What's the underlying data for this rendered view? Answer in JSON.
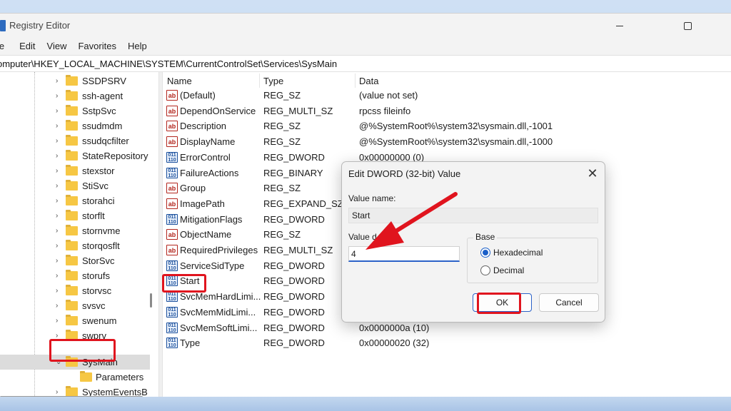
{
  "window": {
    "title": "Registry Editor",
    "menu": [
      "le",
      "Edit",
      "View",
      "Favorites",
      "Help"
    ],
    "address": "omputer\\HKEY_LOCAL_MACHINE\\SYSTEM\\CurrentControlSet\\Services\\SysMain"
  },
  "tree": {
    "items": [
      {
        "label": "SSDPSRV"
      },
      {
        "label": "ssh-agent"
      },
      {
        "label": "SstpSvc"
      },
      {
        "label": "ssudmdm"
      },
      {
        "label": "ssudqcfilter"
      },
      {
        "label": "StateRepository"
      },
      {
        "label": "stexstor"
      },
      {
        "label": "StiSvc"
      },
      {
        "label": "storahci"
      },
      {
        "label": "storflt"
      },
      {
        "label": "stornvme"
      },
      {
        "label": "storqosflt"
      },
      {
        "label": "StorSvc"
      },
      {
        "label": "storufs"
      },
      {
        "label": "storvsc"
      },
      {
        "label": "svsvc"
      },
      {
        "label": "swenum"
      },
      {
        "label": "swprv"
      }
    ],
    "selected": "SysMain",
    "child": "Parameters",
    "next": "SystemEventsB"
  },
  "list": {
    "headers": {
      "name": "Name",
      "type": "Type",
      "data": "Data"
    },
    "rows": [
      {
        "icon": "string-value-icon",
        "name": "(Default)",
        "type": "REG_SZ",
        "data": "(value not set)"
      },
      {
        "icon": "string-value-icon",
        "name": "DependOnService",
        "type": "REG_MULTI_SZ",
        "data": "rpcss fileinfo"
      },
      {
        "icon": "string-value-icon",
        "name": "Description",
        "type": "REG_SZ",
        "data": "@%SystemRoot%\\system32\\sysmain.dll,-1001"
      },
      {
        "icon": "string-value-icon",
        "name": "DisplayName",
        "type": "REG_SZ",
        "data": "@%SystemRoot%\\system32\\sysmain.dll,-1000"
      },
      {
        "icon": "binary-value-icon",
        "name": "ErrorControl",
        "type": "REG_DWORD",
        "data": "0x00000000 (0)"
      },
      {
        "icon": "binary-value-icon",
        "name": "FailureActions",
        "type": "REG_BINARY",
        "data": ""
      },
      {
        "icon": "string-value-icon",
        "name": "Group",
        "type": "REG_SZ",
        "data": ""
      },
      {
        "icon": "string-value-icon",
        "name": "ImagePath",
        "type": "REG_EXPAND_SZ",
        "data": ""
      },
      {
        "icon": "binary-value-icon",
        "name": "MitigationFlags",
        "type": "REG_DWORD",
        "data": ""
      },
      {
        "icon": "string-value-icon",
        "name": "ObjectName",
        "type": "REG_SZ",
        "data": ""
      },
      {
        "icon": "string-value-icon",
        "name": "RequiredPrivileges",
        "type": "REG_MULTI_SZ",
        "data": ""
      },
      {
        "icon": "binary-value-icon",
        "name": "ServiceSidType",
        "type": "REG_DWORD",
        "data": ""
      },
      {
        "icon": "binary-value-icon",
        "name": "Start",
        "type": "REG_DWORD",
        "data": ""
      },
      {
        "icon": "binary-value-icon",
        "name": "SvcMemHardLimi...",
        "type": "REG_DWORD",
        "data": ""
      },
      {
        "icon": "binary-value-icon",
        "name": "SvcMemMidLimi...",
        "type": "REG_DWORD",
        "data": ""
      },
      {
        "icon": "binary-value-icon",
        "name": "SvcMemSoftLimi...",
        "type": "REG_DWORD",
        "data": "0x0000000a (10)"
      },
      {
        "icon": "binary-value-icon",
        "name": "Type",
        "type": "REG_DWORD",
        "data": "0x00000020 (32)"
      }
    ]
  },
  "dialog": {
    "title": "Edit DWORD (32-bit) Value",
    "value_name_label": "Value name:",
    "value_name": "Start",
    "value_data_label": "Value d",
    "value_data": "4",
    "base_label": "Base",
    "hex_label": "Hexadecimal",
    "dec_label": "Decimal",
    "base_selected": "Hexadecimal",
    "ok_label": "OK",
    "cancel_label": "Cancel"
  },
  "colors": {
    "highlight": "#e0141e",
    "accent": "#2b62c8"
  }
}
